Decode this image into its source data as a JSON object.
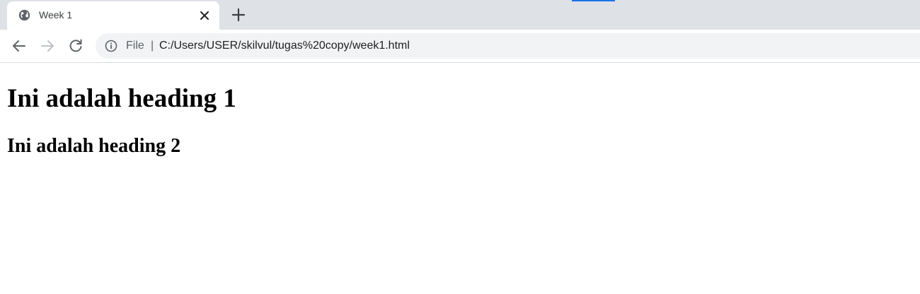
{
  "browser": {
    "tab": {
      "title": "Week 1",
      "favicon": "globe-icon",
      "close_icon": "close-icon"
    },
    "new_tab_icon": "plus-icon",
    "toolbar": {
      "back_icon": "arrow-left-icon",
      "forward_icon": "arrow-right-icon",
      "reload_icon": "reload-icon",
      "omnibox": {
        "info_icon": "info-icon",
        "scheme_label": "File",
        "separator": "|",
        "url": "C:/Users/USER/skilvul/tugas%20copy/week1.html"
      }
    },
    "colors": {
      "tabstrip_bg": "#dee1e6",
      "omnibox_bg": "#f1f3f4",
      "accent": "#1a73e8"
    }
  },
  "page": {
    "heading1": "Ini adalah heading 1",
    "heading2": "Ini adalah heading 2"
  }
}
